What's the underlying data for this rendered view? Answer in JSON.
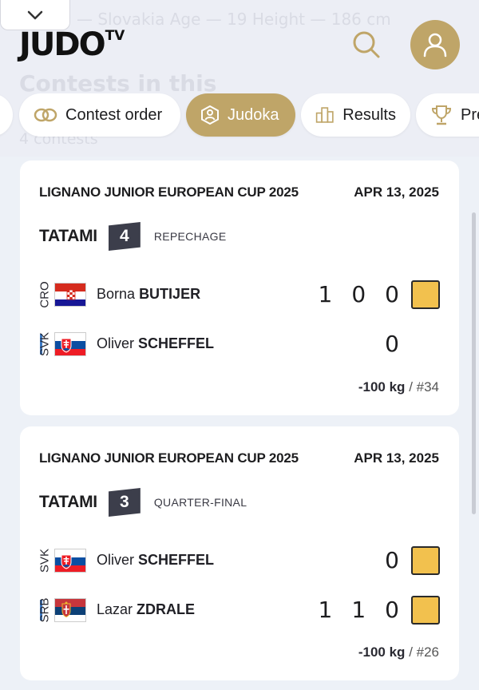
{
  "background": {
    "info_line": "— Slovakia   Age — 19   Height — 186 cm",
    "section_title": "Contests in this",
    "section_subtitle": "4 contests"
  },
  "header": {
    "logo_main": "JUDO",
    "logo_suffix": "TV",
    "icons": {
      "collapse": "chevron-down-icon",
      "search": "search-icon",
      "profile": "user-icon"
    }
  },
  "tabs": [
    {
      "label": "Contest order",
      "icon": "rings-icon",
      "active": false
    },
    {
      "label": "Judoka",
      "icon": "judoka-badge-icon",
      "active": true
    },
    {
      "label": "Results",
      "icon": "bar-chart-icon",
      "active": false
    },
    {
      "label": "Pre",
      "icon": "trophy-icon",
      "active": false
    }
  ],
  "colors": {
    "gold": "#bfa568",
    "penalty_yellow": "#f2c14e",
    "tatami_badge": "#3c3e4b",
    "active_marker": "#3b78c3"
  },
  "contests": [
    {
      "event": "LIGNANO JUNIOR EUROPEAN CUP 2025",
      "date": "APR 13, 2025",
      "tatami_label": "TATAMI",
      "tatami_number": "4",
      "round": "REPECHAGE",
      "athletes": [
        {
          "country": "CRO",
          "first_name": "Borna",
          "last_name": "BUTIJER",
          "scores": [
            "1",
            "0",
            "0"
          ],
          "penalty": true,
          "active": false
        },
        {
          "country": "SVK",
          "first_name": "Oliver",
          "last_name": "SCHEFFEL",
          "scores": [
            "0"
          ],
          "penalty": false,
          "active": true
        }
      ],
      "weight": "-100 kg",
      "contest_no": "/ #34"
    },
    {
      "event": "LIGNANO JUNIOR EUROPEAN CUP 2025",
      "date": "APR 13, 2025",
      "tatami_label": "TATAMI",
      "tatami_number": "3",
      "round": "QUARTER-FINAL",
      "athletes": [
        {
          "country": "SVK",
          "first_name": "Oliver",
          "last_name": "SCHEFFEL",
          "scores": [
            "0"
          ],
          "penalty": true,
          "active": false
        },
        {
          "country": "SRB",
          "first_name": "Lazar",
          "last_name": "ZDRALE",
          "scores": [
            "1",
            "1",
            "0"
          ],
          "penalty": true,
          "active": true
        }
      ],
      "weight": "-100 kg",
      "contest_no": "/ #26"
    }
  ]
}
